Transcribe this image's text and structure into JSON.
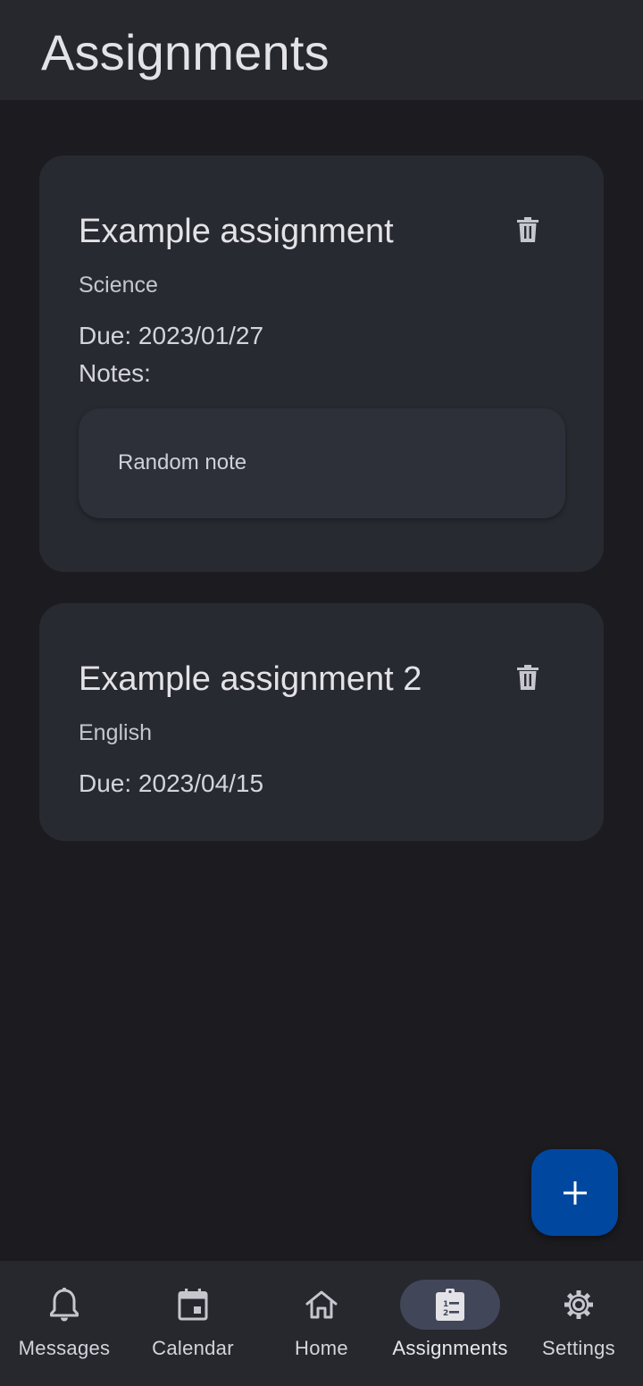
{
  "app_bar": {
    "title": "Assignments"
  },
  "assignments": [
    {
      "title": "Example assignment",
      "subject": "Science",
      "due": "Due: 2023/01/27",
      "notes_label": "Notes:",
      "note": "Random note",
      "delete_icon": "trash-icon"
    },
    {
      "title": "Example assignment 2",
      "subject": "English",
      "due": "Due: 2023/04/15",
      "delete_icon": "trash-icon"
    }
  ],
  "fab": {
    "icon": "plus-icon",
    "color": "#0047a0"
  },
  "nav": {
    "active": "Assignments",
    "items": [
      {
        "label": "Messages",
        "icon": "bell-icon"
      },
      {
        "label": "Calendar",
        "icon": "calendar-icon"
      },
      {
        "label": "Home",
        "icon": "home-icon"
      },
      {
        "label": "Assignments",
        "icon": "assignment-icon"
      },
      {
        "label": "Settings",
        "icon": "gear-icon"
      }
    ]
  },
  "colors": {
    "background": "#1c1c20",
    "surface": "#26282e",
    "card": "#282a31",
    "active_indicator": "#414659"
  }
}
